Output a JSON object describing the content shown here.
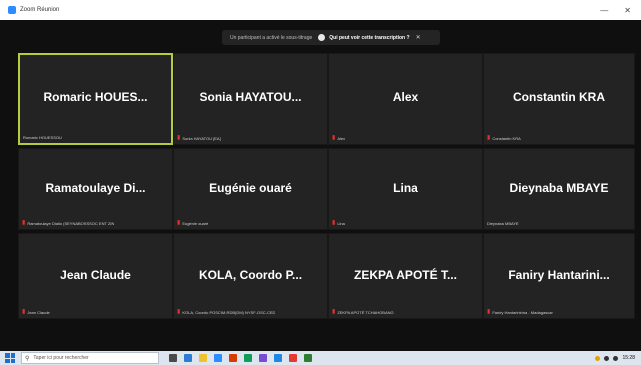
{
  "window": {
    "title": "Zoom Réunion"
  },
  "notification": {
    "message": "Un participant a activé le sous-titrage",
    "link": "Qui peut voir cette transcription ?"
  },
  "tiles": [
    {
      "name": "Romaric  HOUES...",
      "label": "Romaric HOUESSOU",
      "active": true
    },
    {
      "name": "Sonia  HAYATOU...",
      "label": "Sonia HAYATOU [EA]"
    },
    {
      "name": "Alex",
      "label": "Alex"
    },
    {
      "name": "Constantin KRA",
      "label": "Constantin KRA"
    },
    {
      "name": "Ramatoulaye  Di...",
      "label": "Ramatoulaye Diallo (SEYNABOSSSOC ENT ZIN"
    },
    {
      "name": "Eugénie ouaré",
      "label": "Eugénie ouaré"
    },
    {
      "name": "Lina",
      "label": "Lina"
    },
    {
      "name": "Dieynaba MBAYE",
      "label": "Dieynaba MBAYE"
    },
    {
      "name": "Jean Claude",
      "label": "Jean Claude"
    },
    {
      "name": "KOLA, Coordo P...",
      "label": "KOLA, Coordo POSCIM-RDB(DM) NYSF-OSC-CED"
    },
    {
      "name": "ZEKPA APOTÉ T...",
      "label": "ZEKPA APOTÉ TCHAHOBANG"
    },
    {
      "name": "Faniry  Hantarini...",
      "label": "Faniry Hantarinirina - Madagascar"
    }
  ],
  "taskbar": {
    "search_placeholder": "Taper ici pour rechercher",
    "time": "15:28"
  },
  "colors": {
    "active_border": "#b5cd3c",
    "mic_muted": "#e5302c",
    "tile_bg": "#232323"
  }
}
